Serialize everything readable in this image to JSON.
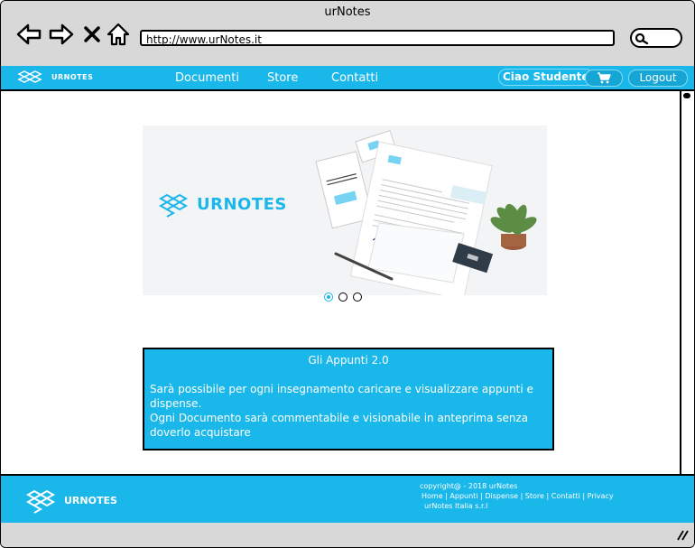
{
  "window": {
    "title": "urNotes"
  },
  "browser": {
    "url": "http://www.urNotes.it"
  },
  "header": {
    "brand": "URNOTES",
    "menu": [
      "Documenti",
      "Store",
      "Contatti"
    ],
    "greeting": "Ciao Studente",
    "logout_label": "Logout"
  },
  "hero": {
    "brand": "URNOTES",
    "active_slide": 1,
    "slide_count": 3
  },
  "info": {
    "title": "Gli Appunti 2.0",
    "line1": "Sarà possibile per ogni insegnamento caricare e visualizzare appunti e dispense.",
    "line2": "Ogni Documento sarà commentabile e visionabile in anteprima senza doverlo acquistare"
  },
  "footer": {
    "brand": "URNOTES",
    "copyright": "copyright@ - 2018 urNotes",
    "links": "Home | Appunti | Dispense | Store | Contatti | Privacy",
    "company": "urNotes Italia s.r.l"
  },
  "colors": {
    "accent": "#1ab7ea",
    "chrome": "#d8d8d8"
  }
}
